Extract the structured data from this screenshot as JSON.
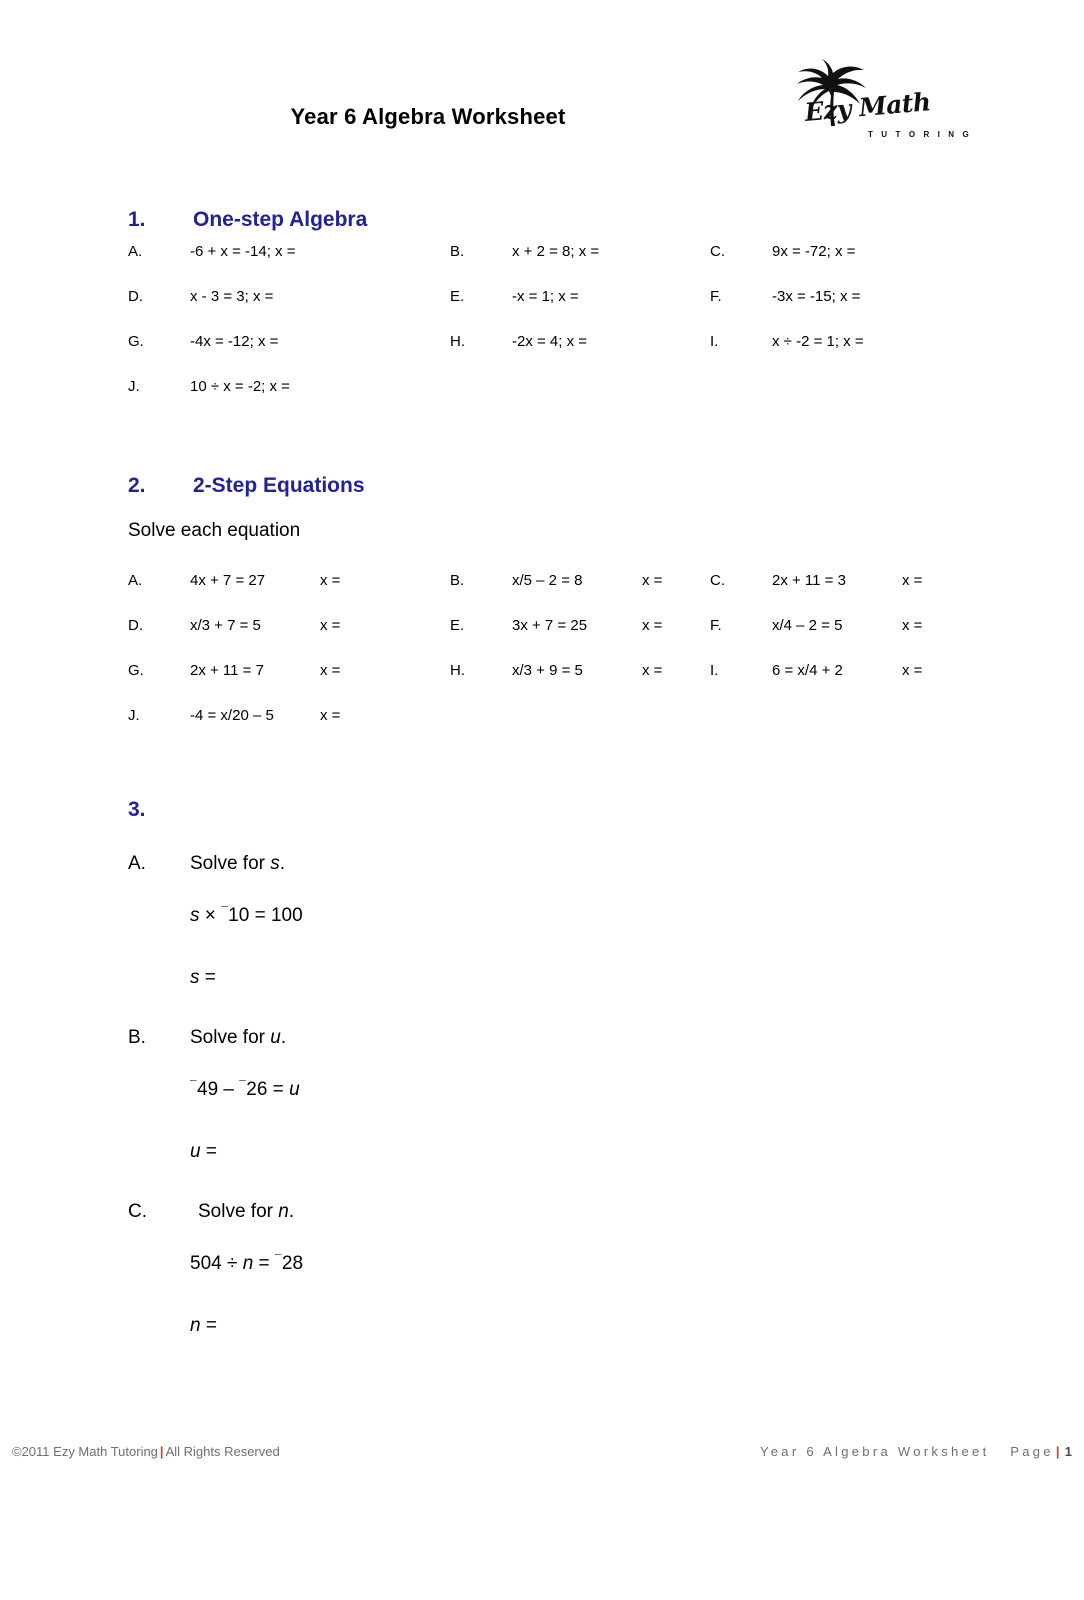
{
  "header": {
    "title": "Year 6 Algebra Worksheet",
    "logo": {
      "icon": "palm-tree-icon",
      "script": "Ezy Math",
      "subtitle": "T U T O R I N G"
    }
  },
  "sections": [
    {
      "number": "1.",
      "title": "One-step Algebra",
      "subtitle": "",
      "problems": [
        {
          "label": "A.",
          "equation": "-6 + x = -14; x ="
        },
        {
          "label": "B.",
          "equation": "x + 2 = 8; x ="
        },
        {
          "label": "C.",
          "equation": "9x = -72; x ="
        },
        {
          "label": "D.",
          "equation": "x - 3 = 3; x ="
        },
        {
          "label": "E.",
          "equation": "-x = 1; x ="
        },
        {
          "label": "F.",
          "equation": "-3x = -15; x ="
        },
        {
          "label": "G.",
          "equation": "-4x = -12; x ="
        },
        {
          "label": "H.",
          "equation": "-2x = 4; x ="
        },
        {
          "label": "I.",
          "equation": "x ÷ -2 = 1; x ="
        },
        {
          "label": "J.",
          "equation": "10 ÷ x = -2; x ="
        }
      ]
    },
    {
      "number": "2.",
      "title": "2-Step Equations",
      "subtitle": "Solve each equation",
      "answer_prompt": "x =",
      "problems": [
        {
          "label": "A.",
          "equation": "4x + 7 = 27",
          "answer": "x ="
        },
        {
          "label": "B.",
          "equation": "x/5 – 2 = 8",
          "answer": "x ="
        },
        {
          "label": "C.",
          "equation": "2x + 11 = 3",
          "answer": "x ="
        },
        {
          "label": "D.",
          "equation": "x/3 + 7 = 5",
          "answer": "x ="
        },
        {
          "label": "E.",
          "equation": "3x + 7 = 25",
          "answer": "x ="
        },
        {
          "label": "F.",
          "equation": "x/4 – 2 = 5",
          "answer": "x ="
        },
        {
          "label": "G.",
          "equation": "2x + 11 = 7",
          "answer": "x ="
        },
        {
          "label": "H.",
          "equation": "x/3 + 9 = 5",
          "answer": "x ="
        },
        {
          "label": "I.",
          "equation": "6 = x/4 + 2",
          "answer": "x ="
        },
        {
          "label": "J.",
          "equation": "-4 = x/20 – 5",
          "answer": "x ="
        }
      ]
    }
  ],
  "section3": {
    "number": "3.",
    "title": "",
    "items": [
      {
        "label": "A.",
        "prompt_prefix": "Solve for ",
        "prompt_var": "s",
        "prompt_suffix": ".",
        "equation_parts": [
          {
            "type": "var",
            "text": "s"
          },
          {
            "type": "plain",
            "text": " × "
          },
          {
            "type": "negsup",
            "text": "¯"
          },
          {
            "type": "plain",
            "text": "10 = 100"
          }
        ],
        "answer_var": "s",
        "answer_suffix": " ="
      },
      {
        "label": "B.",
        "prompt_prefix": "Solve for ",
        "prompt_var": "u",
        "prompt_suffix": ".",
        "equation_parts": [
          {
            "type": "negsup",
            "text": "¯"
          },
          {
            "type": "plain",
            "text": "49 – "
          },
          {
            "type": "negsup",
            "text": "¯"
          },
          {
            "type": "plain",
            "text": "26 = "
          },
          {
            "type": "var",
            "text": "u"
          }
        ],
        "answer_var": "u",
        "answer_suffix": " ="
      },
      {
        "label": "C.",
        "prompt_prefix": "Solve for ",
        "prompt_var": "n",
        "prompt_suffix": ".",
        "equation_parts": [
          {
            "type": "plain",
            "text": "504 ÷ "
          },
          {
            "type": "var",
            "text": "n"
          },
          {
            "type": "plain",
            "text": " = "
          },
          {
            "type": "negsup",
            "text": "¯"
          },
          {
            "type": "plain",
            "text": "28"
          }
        ],
        "answer_var": "n",
        "answer_suffix": " ="
      }
    ]
  },
  "footer": {
    "copyright": "©2011 Ezy Math Tutoring",
    "separator": "|",
    "rights": "All Rights Reserved",
    "doc_name": "Year 6 Algebra Worksheet",
    "page_label": "Page",
    "page_number": "1"
  },
  "colors": {
    "heading": "#21219c",
    "text": "#000000",
    "footer": "#6f6f6f",
    "separator": "#b9473f"
  }
}
